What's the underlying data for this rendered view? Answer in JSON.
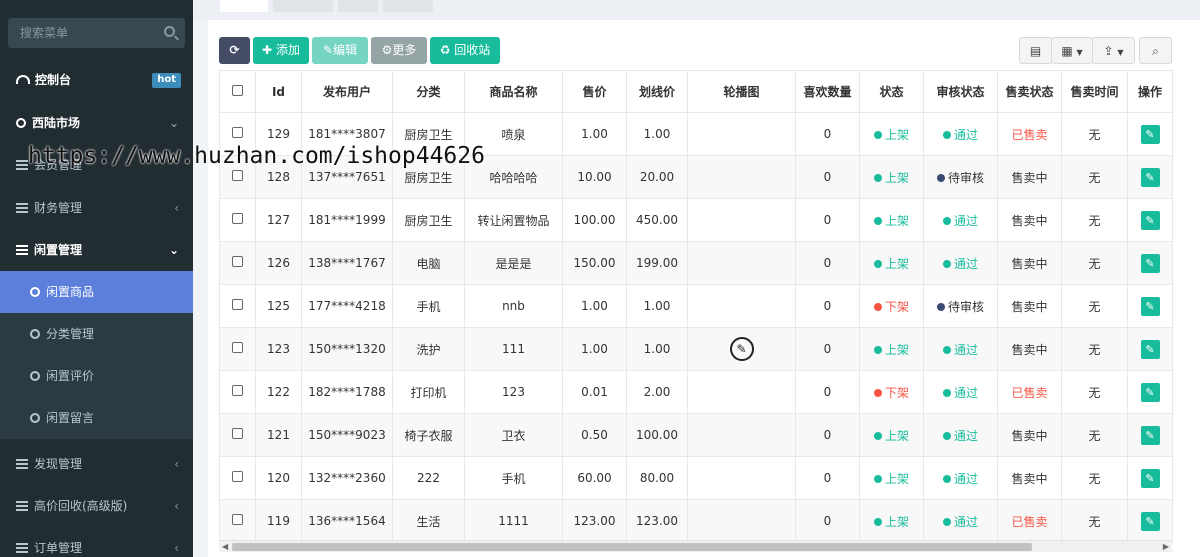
{
  "sidebar": {
    "search_placeholder": "搜索菜单",
    "dashboard": "控制台",
    "hot_badge": "hot",
    "items": [
      {
        "label": "西陆市场",
        "expanded": true
      },
      {
        "label": "会员管理"
      },
      {
        "label": "财务管理"
      },
      {
        "label": "闲置管理",
        "expanded": true
      },
      {
        "label": "闲置商品",
        "active": true
      },
      {
        "label": "分类管理"
      },
      {
        "label": "闲置评价"
      },
      {
        "label": "闲置留言"
      },
      {
        "label": "发现管理"
      },
      {
        "label": "高价回收(高级版)"
      },
      {
        "label": "订单管理"
      }
    ]
  },
  "toolbar": {
    "add_label": "添加",
    "edit_label": "编辑",
    "more_label": "更多",
    "recycle_label": "回收站"
  },
  "table": {
    "columns": [
      "Id",
      "发布用户",
      "分类",
      "商品名称",
      "售价",
      "划线价",
      "轮播图",
      "喜欢数量",
      "状态",
      "审核状态",
      "售卖状态",
      "售卖时间",
      "操作"
    ],
    "rows": [
      {
        "id": "129",
        "user": "181****3807",
        "category": "厨房卫生",
        "name": "喷泉",
        "price": "1.00",
        "orig": "1.00",
        "likes": "0",
        "status": "上架",
        "audit": "通过",
        "sale": "已售卖",
        "time": "无"
      },
      {
        "id": "128",
        "user": "137****7651",
        "category": "厨房卫生",
        "name": "哈哈哈哈",
        "price": "10.00",
        "orig": "20.00",
        "likes": "0",
        "status": "上架",
        "audit": "待审核",
        "sale": "售卖中",
        "time": "无"
      },
      {
        "id": "127",
        "user": "181****1999",
        "category": "厨房卫生",
        "name": "转让闲置物品",
        "price": "100.00",
        "orig": "450.00",
        "likes": "0",
        "status": "上架",
        "audit": "通过",
        "sale": "售卖中",
        "time": "无"
      },
      {
        "id": "126",
        "user": "138****1767",
        "category": "电脑",
        "name": "是是是",
        "price": "150.00",
        "orig": "199.00",
        "likes": "0",
        "status": "上架",
        "audit": "通过",
        "sale": "售卖中",
        "time": "无"
      },
      {
        "id": "125",
        "user": "177****4218",
        "category": "手机",
        "name": "nnb",
        "price": "1.00",
        "orig": "1.00",
        "likes": "0",
        "status": "下架",
        "audit": "待审核",
        "sale": "售卖中",
        "time": "无"
      },
      {
        "id": "123",
        "user": "150****1320",
        "category": "洗护",
        "name": "111",
        "price": "1.00",
        "orig": "1.00",
        "likes": "0",
        "status": "上架",
        "audit": "通过",
        "sale": "售卖中",
        "time": "无",
        "has_image": true
      },
      {
        "id": "122",
        "user": "182****1788",
        "category": "打印机",
        "name": "123",
        "price": "0.01",
        "orig": "2.00",
        "likes": "0",
        "status": "下架",
        "audit": "通过",
        "sale": "已售卖",
        "time": "无"
      },
      {
        "id": "121",
        "user": "150****9023",
        "category": "椅子衣服",
        "name": "卫衣",
        "price": "0.50",
        "orig": "100.00",
        "likes": "0",
        "status": "上架",
        "audit": "通过",
        "sale": "售卖中",
        "time": "无"
      },
      {
        "id": "120",
        "user": "132****2360",
        "category": "222",
        "name": "手机",
        "price": "60.00",
        "orig": "80.00",
        "likes": "0",
        "status": "上架",
        "audit": "通过",
        "sale": "售卖中",
        "time": "无"
      },
      {
        "id": "119",
        "user": "136****1564",
        "category": "生活",
        "name": "1111",
        "price": "123.00",
        "orig": "123.00",
        "likes": "0",
        "status": "上架",
        "audit": "通过",
        "sale": "已售卖",
        "time": "无"
      }
    ]
  },
  "watermark": "https://www.huzhan.com/ishop44626",
  "colors": {
    "accent": "#18bc9c",
    "danger": "#f75444",
    "pending": "#3a4a70",
    "sidebar": "#222d32",
    "active": "#5c7fdc"
  }
}
